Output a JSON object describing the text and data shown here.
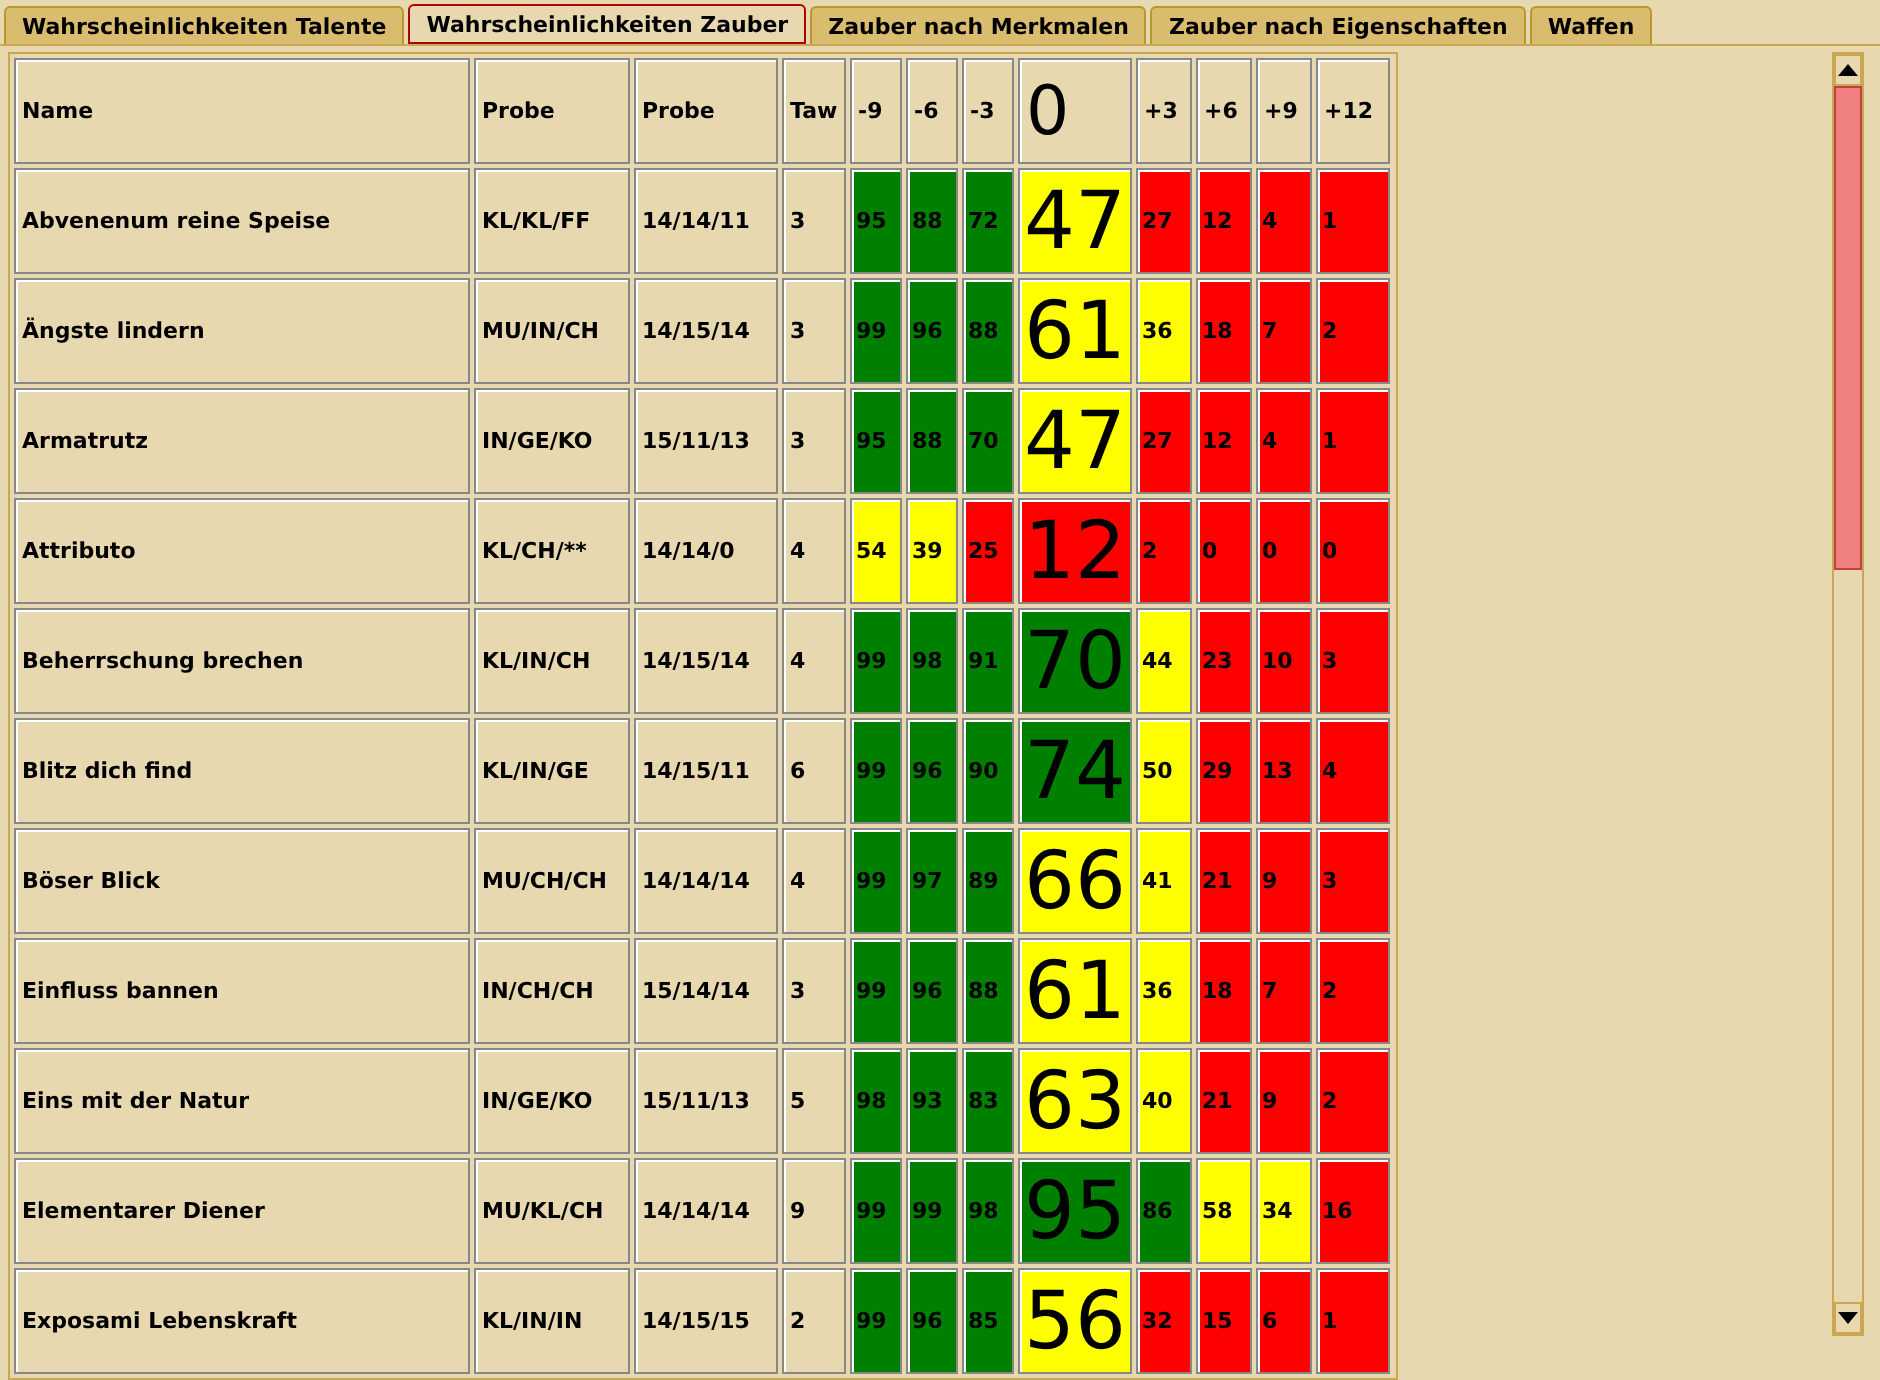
{
  "tabs": [
    {
      "label": "Wahrscheinlichkeiten Talente",
      "selected": false
    },
    {
      "label": "Wahrscheinlichkeiten Zauber",
      "selected": true
    },
    {
      "label": "Zauber nach Merkmalen",
      "selected": false
    },
    {
      "label": "Zauber nach Eigenschaften",
      "selected": false
    },
    {
      "label": "Waffen",
      "selected": false
    }
  ],
  "table": {
    "columns": [
      "Name",
      "Probe",
      "Probe",
      "Taw",
      "-9",
      "-6",
      "-3",
      "0",
      "+3",
      "+6",
      "+9",
      "+12"
    ],
    "rows": [
      [
        {
          "value": "Abvenenum reine Speise"
        },
        {
          "value": "KL/KL/FF"
        },
        {
          "value": "14/14/11"
        },
        {
          "value": "3"
        },
        {
          "value": "95",
          "color": "#008000"
        },
        {
          "value": "88",
          "color": "#008000"
        },
        {
          "value": "72",
          "color": "#008000"
        },
        {
          "value": "47",
          "color": "#ffff00"
        },
        {
          "value": "27",
          "color": "#ff0000"
        },
        {
          "value": "12",
          "color": "#ff0000"
        },
        {
          "value": "4",
          "color": "#ff0000"
        },
        {
          "value": "1",
          "color": "#ff0000"
        }
      ],
      [
        {
          "value": "Ängste lindern"
        },
        {
          "value": "MU/IN/CH"
        },
        {
          "value": "14/15/14"
        },
        {
          "value": "3"
        },
        {
          "value": "99",
          "color": "#008000"
        },
        {
          "value": "96",
          "color": "#008000"
        },
        {
          "value": "88",
          "color": "#008000"
        },
        {
          "value": "61",
          "color": "#ffff00"
        },
        {
          "value": "36",
          "color": "#ffff00"
        },
        {
          "value": "18",
          "color": "#ff0000"
        },
        {
          "value": "7",
          "color": "#ff0000"
        },
        {
          "value": "2",
          "color": "#ff0000"
        }
      ],
      [
        {
          "value": "Armatrutz"
        },
        {
          "value": "IN/GE/KO"
        },
        {
          "value": "15/11/13"
        },
        {
          "value": "3"
        },
        {
          "value": "95",
          "color": "#008000"
        },
        {
          "value": "88",
          "color": "#008000"
        },
        {
          "value": "70",
          "color": "#008000"
        },
        {
          "value": "47",
          "color": "#ffff00"
        },
        {
          "value": "27",
          "color": "#ff0000"
        },
        {
          "value": "12",
          "color": "#ff0000"
        },
        {
          "value": "4",
          "color": "#ff0000"
        },
        {
          "value": "1",
          "color": "#ff0000"
        }
      ],
      [
        {
          "value": "Attributo"
        },
        {
          "value": "KL/CH/**"
        },
        {
          "value": "14/14/0"
        },
        {
          "value": "4"
        },
        {
          "value": "54",
          "color": "#ffff00"
        },
        {
          "value": "39",
          "color": "#ffff00"
        },
        {
          "value": "25",
          "color": "#ff0000"
        },
        {
          "value": "12",
          "color": "#ff0000"
        },
        {
          "value": "2",
          "color": "#ff0000"
        },
        {
          "value": "0",
          "color": "#ff0000"
        },
        {
          "value": "0",
          "color": "#ff0000"
        },
        {
          "value": "0",
          "color": "#ff0000"
        }
      ],
      [
        {
          "value": "Beherrschung brechen"
        },
        {
          "value": "KL/IN/CH"
        },
        {
          "value": "14/15/14"
        },
        {
          "value": "4"
        },
        {
          "value": "99",
          "color": "#008000"
        },
        {
          "value": "98",
          "color": "#008000"
        },
        {
          "value": "91",
          "color": "#008000"
        },
        {
          "value": "70",
          "color": "#008000"
        },
        {
          "value": "44",
          "color": "#ffff00"
        },
        {
          "value": "23",
          "color": "#ff0000"
        },
        {
          "value": "10",
          "color": "#ff0000"
        },
        {
          "value": "3",
          "color": "#ff0000"
        }
      ],
      [
        {
          "value": "Blitz dich find"
        },
        {
          "value": "KL/IN/GE"
        },
        {
          "value": "14/15/11"
        },
        {
          "value": "6"
        },
        {
          "value": "99",
          "color": "#008000"
        },
        {
          "value": "96",
          "color": "#008000"
        },
        {
          "value": "90",
          "color": "#008000"
        },
        {
          "value": "74",
          "color": "#008000"
        },
        {
          "value": "50",
          "color": "#ffff00"
        },
        {
          "value": "29",
          "color": "#ff0000"
        },
        {
          "value": "13",
          "color": "#ff0000"
        },
        {
          "value": "4",
          "color": "#ff0000"
        }
      ],
      [
        {
          "value": "Böser Blick"
        },
        {
          "value": "MU/CH/CH"
        },
        {
          "value": "14/14/14"
        },
        {
          "value": "4"
        },
        {
          "value": "99",
          "color": "#008000"
        },
        {
          "value": "97",
          "color": "#008000"
        },
        {
          "value": "89",
          "color": "#008000"
        },
        {
          "value": "66",
          "color": "#ffff00"
        },
        {
          "value": "41",
          "color": "#ffff00"
        },
        {
          "value": "21",
          "color": "#ff0000"
        },
        {
          "value": "9",
          "color": "#ff0000"
        },
        {
          "value": "3",
          "color": "#ff0000"
        }
      ],
      [
        {
          "value": "Einfluss bannen"
        },
        {
          "value": "IN/CH/CH"
        },
        {
          "value": "15/14/14"
        },
        {
          "value": "3"
        },
        {
          "value": "99",
          "color": "#008000"
        },
        {
          "value": "96",
          "color": "#008000"
        },
        {
          "value": "88",
          "color": "#008000"
        },
        {
          "value": "61",
          "color": "#ffff00"
        },
        {
          "value": "36",
          "color": "#ffff00"
        },
        {
          "value": "18",
          "color": "#ff0000"
        },
        {
          "value": "7",
          "color": "#ff0000"
        },
        {
          "value": "2",
          "color": "#ff0000"
        }
      ],
      [
        {
          "value": "Eins mit der Natur"
        },
        {
          "value": "IN/GE/KO"
        },
        {
          "value": "15/11/13"
        },
        {
          "value": "5"
        },
        {
          "value": "98",
          "color": "#008000"
        },
        {
          "value": "93",
          "color": "#008000"
        },
        {
          "value": "83",
          "color": "#008000"
        },
        {
          "value": "63",
          "color": "#ffff00"
        },
        {
          "value": "40",
          "color": "#ffff00"
        },
        {
          "value": "21",
          "color": "#ff0000"
        },
        {
          "value": "9",
          "color": "#ff0000"
        },
        {
          "value": "2",
          "color": "#ff0000"
        }
      ],
      [
        {
          "value": "Elementarer Diener"
        },
        {
          "value": "MU/KL/CH"
        },
        {
          "value": "14/14/14"
        },
        {
          "value": "9"
        },
        {
          "value": "99",
          "color": "#008000"
        },
        {
          "value": "99",
          "color": "#008000"
        },
        {
          "value": "98",
          "color": "#008000"
        },
        {
          "value": "95",
          "color": "#008000"
        },
        {
          "value": "86",
          "color": "#008000"
        },
        {
          "value": "58",
          "color": "#ffff00"
        },
        {
          "value": "34",
          "color": "#ffff00"
        },
        {
          "value": "16",
          "color": "#ff0000"
        }
      ],
      [
        {
          "value": "Exposami Lebenskraft"
        },
        {
          "value": "KL/IN/IN"
        },
        {
          "value": "14/15/15"
        },
        {
          "value": "2"
        },
        {
          "value": "99",
          "color": "#008000"
        },
        {
          "value": "96",
          "color": "#008000"
        },
        {
          "value": "85",
          "color": "#008000"
        },
        {
          "value": "56",
          "color": "#ffff00"
        },
        {
          "value": "32",
          "color": "#ff0000"
        },
        {
          "value": "15",
          "color": "#ff0000"
        },
        {
          "value": "6",
          "color": "#ff0000"
        },
        {
          "value": "1",
          "color": "#ff0000"
        }
      ]
    ]
  }
}
